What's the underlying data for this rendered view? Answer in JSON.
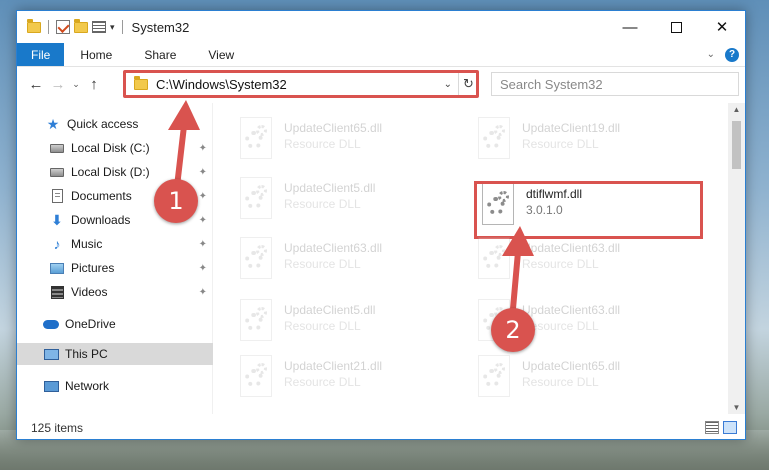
{
  "window": {
    "title": "System32",
    "minimize_glyph": "—",
    "close_glyph": "✕"
  },
  "ribbon": {
    "tabs": [
      "File",
      "Home",
      "Share",
      "View"
    ]
  },
  "navbar": {
    "back_glyph": "←",
    "forward_glyph": "→",
    "recent_glyph": "⌄",
    "up_glyph": "↑",
    "address": "C:\\Windows\\System32",
    "refresh_glyph": "↻",
    "search_placeholder": "Search System32"
  },
  "sidebar": {
    "items": [
      {
        "label": "Quick access",
        "icon": "star-icon",
        "pinned": false
      },
      {
        "label": "Local Disk (C:)",
        "icon": "disk-icon",
        "pinned": true
      },
      {
        "label": "Local Disk (D:)",
        "icon": "disk-icon",
        "pinned": true
      },
      {
        "label": "Documents",
        "icon": "documents-icon",
        "pinned": true
      },
      {
        "label": "Downloads",
        "icon": "downloads-icon",
        "pinned": true
      },
      {
        "label": "Music",
        "icon": "music-icon",
        "pinned": true
      },
      {
        "label": "Pictures",
        "icon": "pictures-icon",
        "pinned": true
      },
      {
        "label": "Videos",
        "icon": "videos-icon",
        "pinned": true
      },
      {
        "label": "OneDrive",
        "icon": "onedrive-icon",
        "pinned": false
      },
      {
        "label": "This PC",
        "icon": "this-pc-icon",
        "pinned": false,
        "selected": true
      },
      {
        "label": "Network",
        "icon": "network-icon",
        "pinned": false
      }
    ],
    "pin_glyph": "📌"
  },
  "files": [
    {
      "name": "UpdateClient65.dll",
      "desc": "Resource DLL",
      "faded": true
    },
    {
      "name": "UpdateClient19.dll",
      "desc": "Resource DLL",
      "faded": true
    },
    {
      "name": "UpdateClient5.dll",
      "desc": "Resource DLL",
      "faded": true
    },
    {
      "name": "dtiflwmf.dll",
      "desc": "3.0.1.0",
      "faded": false
    },
    {
      "name": "UpdateClient63.dll",
      "desc": "Resource DLL",
      "faded": true
    },
    {
      "name": "UpdateClient63.dll",
      "desc": "Resource DLL",
      "faded": true
    },
    {
      "name": "UpdateClient5.dll",
      "desc": "Resource DLL",
      "faded": true
    },
    {
      "name": "UpdateClient63.dll",
      "desc": "Resource DLL",
      "faded": true
    },
    {
      "name": "UpdateClient21.dll",
      "desc": "Resource DLL",
      "faded": true
    },
    {
      "name": "UpdateClient65.dll",
      "desc": "Resource DLL",
      "faded": true
    }
  ],
  "status": {
    "item_count": "125 items"
  },
  "annotations": {
    "step1": "1",
    "step2": "2",
    "color": "#d9534f"
  }
}
